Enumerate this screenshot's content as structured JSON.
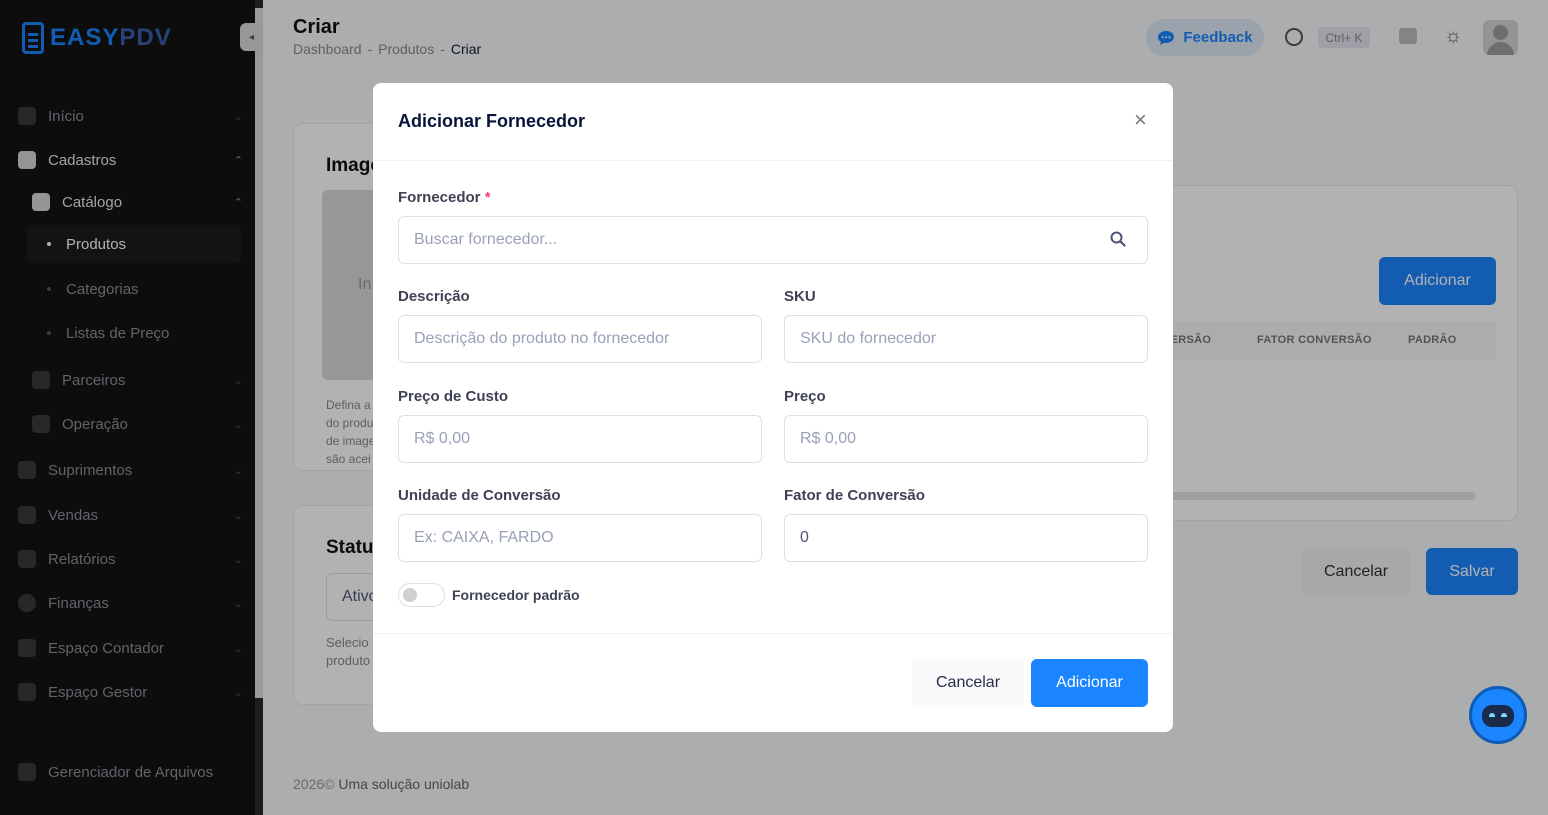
{
  "brand": {
    "part1": "EASY",
    "part2": "PDV"
  },
  "sidebar": {
    "inicio": "Início",
    "cadastros": "Cadastros",
    "catalogo": "Catálogo",
    "produtos": "Produtos",
    "categorias": "Categorias",
    "listas_preco": "Listas de Preço",
    "parceiros": "Parceiros",
    "operacao": "Operação",
    "suprimentos": "Suprimentos",
    "vendas": "Vendas",
    "relatorios": "Relatórios",
    "financas": "Finanças",
    "espaco_contador": "Espaço Contador",
    "espaco_gestor": "Espaço Gestor",
    "gerenciador": "Gerenciador de Arquivos"
  },
  "header": {
    "title": "Criar",
    "breadcrumb": [
      "Dashboard",
      "-",
      "Produtos",
      "-",
      "Criar"
    ],
    "feedback_label": "Feedback",
    "shortcut": "Ctrl+ K"
  },
  "background": {
    "imagem_title": "Image",
    "img_hint": "In",
    "img_desc": [
      "Defina a",
      "do produ",
      "de image",
      "são acei"
    ],
    "status_title": "Statu",
    "status_value": "Ativo",
    "status_desc": [
      "Selecio",
      "produto"
    ],
    "adicionar_label": "Adicionar",
    "table_headers": [
      "VERSÃO",
      "FATOR CONVERSÃO",
      "PADRÃO"
    ],
    "cancel_label": "Cancelar",
    "save_label": "Salvar"
  },
  "modal": {
    "title": "Adicionar Fornecedor",
    "fornecedor_label": "Fornecedor",
    "required_mark": "*",
    "fornecedor_placeholder": "Buscar fornecedor...",
    "descricao_label": "Descrição",
    "descricao_placeholder": "Descrição do produto no fornecedor",
    "sku_label": "SKU",
    "sku_placeholder": "SKU do fornecedor",
    "preco_custo_label": "Preço de Custo",
    "preco_custo_placeholder": "R$ 0,00",
    "preco_label": "Preço",
    "preco_placeholder": "R$ 0,00",
    "unidade_label": "Unidade de Conversão",
    "unidade_placeholder": "Ex: CAIXA, FARDO",
    "fator_label": "Fator de Conversão",
    "fator_value": "0",
    "padrao_label": "Fornecedor padrão",
    "cancel_label": "Cancelar",
    "add_label": "Adicionar"
  },
  "footer": {
    "year": "2026©",
    "text": "Uma solução uniolab"
  },
  "colors": {
    "primary": "#1b84ff",
    "sidebar_bg": "#131313",
    "required": "#f1416c"
  }
}
